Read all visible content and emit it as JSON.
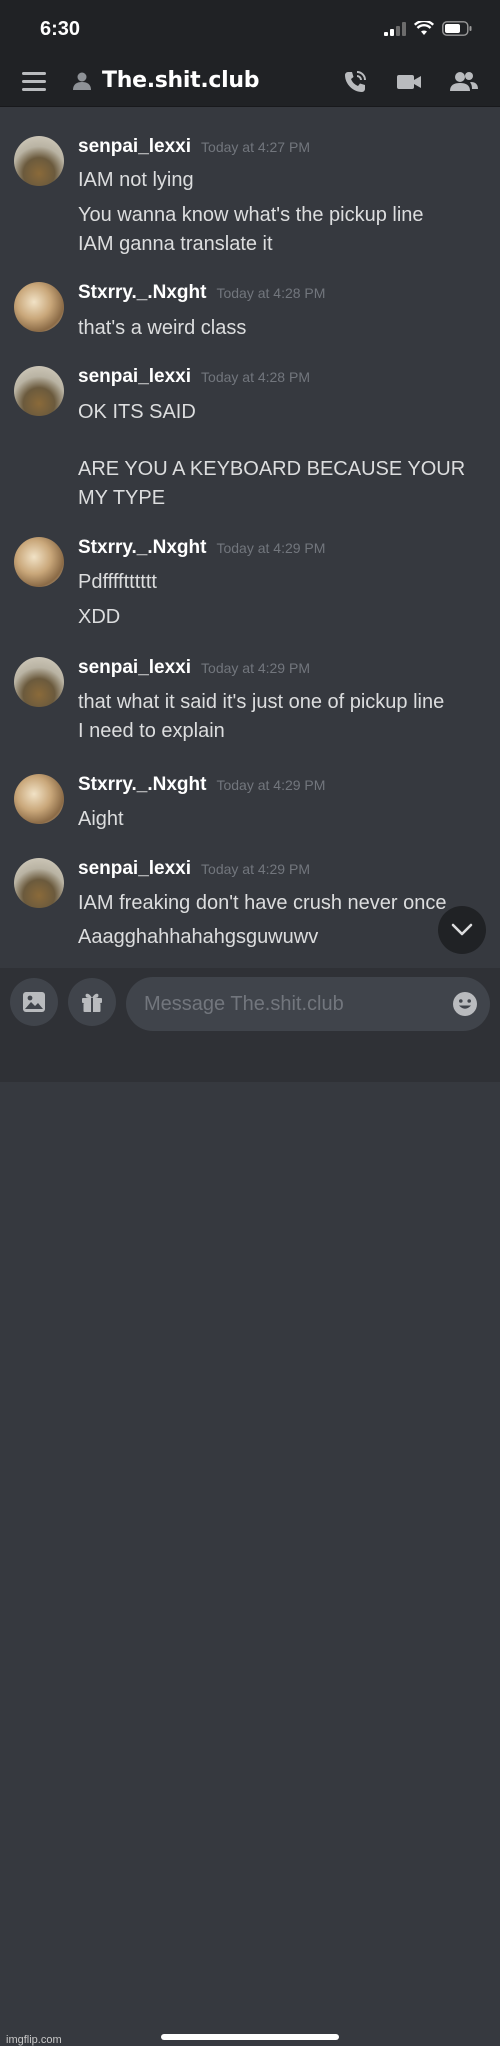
{
  "status_bar": {
    "time": "6:30"
  },
  "header": {
    "channel_name": "The.shit.club"
  },
  "messages": [
    {
      "author": "senpai_lexxi",
      "timestamp": "Today at 4:27 PM",
      "lines": [
        "IAM not lying",
        "You wanna know what's the pickup line",
        "IAM ganna translate it"
      ]
    },
    {
      "author": "Stxrry._.Nxght",
      "timestamp": "Today at 4:28 PM",
      "lines": [
        "that's a weird class"
      ]
    },
    {
      "author": "senpai_lexxi",
      "timestamp": "Today at 4:28 PM",
      "lines": [
        "OK ITS SAID",
        "ARE YOU A KEYBOARD BECAUSE YOUR",
        "MY TYPE"
      ]
    },
    {
      "author": "Stxrry._.Nxght",
      "timestamp": "Today at 4:29 PM",
      "lines": [
        "Pdfffftttttt",
        "XDD"
      ]
    },
    {
      "author": "senpai_lexxi",
      "timestamp": "Today at 4:29 PM",
      "lines": [
        "that what it said it's just one of pickup line",
        "I need to explain"
      ]
    },
    {
      "author": "Stxrry._.Nxght",
      "timestamp": "Today at 4:29 PM",
      "lines": [
        "Aight"
      ]
    },
    {
      "author": "senpai_lexxi",
      "timestamp": "Today at 4:29 PM",
      "lines": [
        "IAM freaking don't have crush never once",
        "Aaagghahhahahgsguwuwv"
      ]
    }
  ],
  "composer": {
    "placeholder": "Message The.shit.club"
  },
  "watermark": "imgflip.com",
  "colors": {
    "background": "#36393f",
    "header": "#202225",
    "input": "#40444b",
    "timestamp": "#72767d"
  },
  "icons": [
    "hamburger-icon",
    "user-icon",
    "phone-icon",
    "video-icon",
    "members-icon",
    "image-icon",
    "gift-icon",
    "emoji-icon",
    "chevron-down-icon"
  ]
}
